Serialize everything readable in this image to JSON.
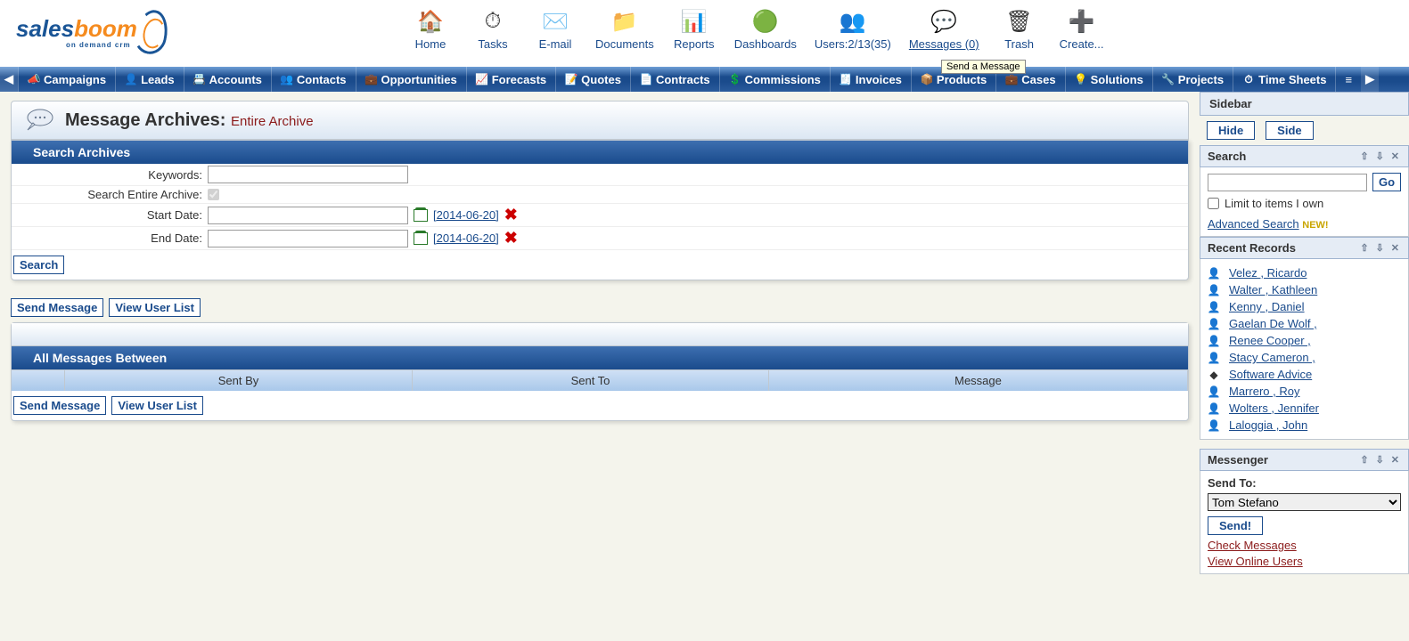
{
  "logo": {
    "part1": "sales",
    "part2": "boom",
    "sub": "on demand crm"
  },
  "topIcons": [
    {
      "label": "Home",
      "icon": "🏠"
    },
    {
      "label": "Tasks",
      "icon": "⏱"
    },
    {
      "label": "E-mail",
      "icon": "✉️"
    },
    {
      "label": "Documents",
      "icon": "📁"
    },
    {
      "label": "Reports",
      "icon": "📊"
    },
    {
      "label": "Dashboards",
      "icon": "🟢"
    },
    {
      "label": "Users:2/13(35)",
      "icon": "👥"
    },
    {
      "label": "Messages (0)",
      "icon": "💬",
      "active": true
    },
    {
      "label": "Trash",
      "icon": "🗑"
    },
    {
      "label": "Create...",
      "icon": "➕"
    }
  ],
  "tooltip": "Send a Message",
  "nav": [
    "Campaigns",
    "Leads",
    "Accounts",
    "Contacts",
    "Opportunities",
    "Forecasts",
    "Quotes",
    "Contracts",
    "Commissions",
    "Invoices",
    "Products",
    "Cases",
    "Solutions",
    "Projects",
    "Time Sheets"
  ],
  "navIcons": [
    "📣",
    "👤",
    "📇",
    "👥",
    "💼",
    "📈",
    "📝",
    "📄",
    "💲",
    "🧾",
    "📦",
    "💼",
    "💡",
    "🔧",
    "⏱"
  ],
  "page": {
    "title": "Message Archives:",
    "subtitle": "Entire Archive"
  },
  "searchPanel": {
    "title": "Search Archives",
    "keywordsLabel": "Keywords:",
    "keywordsValue": "",
    "entireLabel": "Search Entire Archive:",
    "entireChecked": true,
    "startLabel": "Start Date:",
    "startValue": "",
    "startHint": "[2014-06-20]",
    "endLabel": "End Date:",
    "endValue": "",
    "endHint": "[2014-06-20]",
    "searchBtn": "Search"
  },
  "actionButtons": {
    "send": "Send Message",
    "viewUsers": "View User List"
  },
  "messagesPanel": {
    "title": "All Messages Between",
    "columns": {
      "sentBy": "Sent By",
      "sentTo": "Sent To",
      "message": "Message"
    }
  },
  "sidebar": {
    "title": "Sidebar",
    "hide": "Hide",
    "side": "Side",
    "search": {
      "title": "Search",
      "go": "Go",
      "limit": "Limit to items I own",
      "advanced": "Advanced Search",
      "newBadge": "NEW!"
    },
    "recent": {
      "title": "Recent Records",
      "items": [
        "Velez , Ricardo",
        "Walter , Kathleen",
        "Kenny , Daniel",
        "Gaelan De Wolf ,",
        "Renee Cooper ,",
        "Stacy Cameron ,",
        "Software Advice",
        "Marrero , Roy",
        "Wolters , Jennifer",
        "Laloggia , John"
      ]
    },
    "messenger": {
      "title": "Messenger",
      "sendTo": "Send To:",
      "selected": "Tom Stefano",
      "sendBtn": "Send!",
      "check": "Check Messages",
      "online": "View Online Users"
    }
  }
}
